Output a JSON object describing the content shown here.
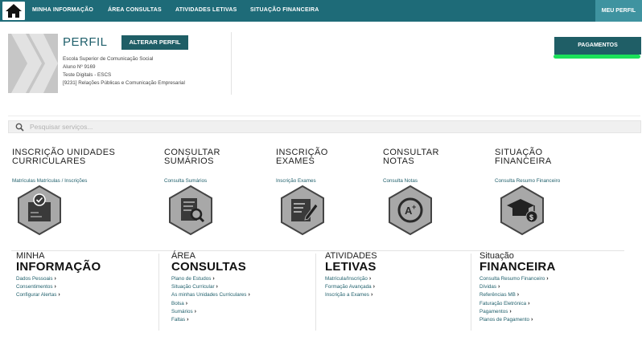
{
  "nav": {
    "items": [
      "MINHA INFORMAÇÃO",
      "ÁREA CONSULTAS",
      "ATIVIDADES LETIVAS",
      "SITUAÇÃO FINANCEIRA"
    ],
    "meu_perfil": "MEU PERFIL",
    "home_icon": "home-icon"
  },
  "profile": {
    "title": "PERFIL",
    "alterar_label": "ALTERAR PERFIL",
    "lines": [
      "Escola Superior de Comunicação Social",
      "Aluno Nº 9169",
      "Teste Digitals - ESCS",
      "[9231] Relações Públicas e Comunicação Empresarial"
    ],
    "pagamentos_label": "PAGAMENTOS"
  },
  "search": {
    "placeholder": "Pesquisar serviços..."
  },
  "tiles": [
    {
      "title": "INSCRIÇÃO UNIDADES CURRICULARES",
      "link": "Matrículas Matrículas / Inscrições",
      "icon": "enrollment-icon"
    },
    {
      "title": "CONSULTAR SUMÁRIOS",
      "link": "Consulta Sumários",
      "icon": "document-search-icon"
    },
    {
      "title": "INSCRIÇÃO EXAMES",
      "link": "Inscrição Exames",
      "icon": "exam-edit-icon"
    },
    {
      "title": "CONSULTAR NOTAS",
      "link": "Consulta Notas",
      "icon": "grades-icon"
    },
    {
      "title": "SITUAÇÃO FINANCEIRA",
      "link": "Consulta Resumo Financeiro",
      "icon": "graduation-money-icon"
    }
  ],
  "sections": [
    {
      "sub": "MINHA",
      "main": "INFORMAÇÃO",
      "links": [
        "Dados Pessoais",
        "Consentimentos",
        "Configurar Alertas"
      ]
    },
    {
      "sub": "ÁREA",
      "main": "CONSULTAS",
      "links": [
        "Plano de Estudos",
        "Situação Curricular",
        "As minhas Unidades Curriculares",
        "Bolsa",
        "Sumários",
        "Faltas"
      ]
    },
    {
      "sub": "ATIVIDADES",
      "main": "LETIVAS",
      "links": [
        "Matrícula/Inscrição",
        "Formação Avançada",
        "Inscrição a Exames"
      ]
    },
    {
      "sub": "Situação",
      "main": "FINANCEIRA",
      "links": [
        "Consulta Resumo Financeiro",
        "Dívidas",
        "Referências MB",
        "Faturação Eletrónica",
        "Pagamentos",
        "Planos de Pagamento"
      ]
    }
  ],
  "colors": {
    "teal": "#1e6b78",
    "accent_green": "#1be05a"
  }
}
